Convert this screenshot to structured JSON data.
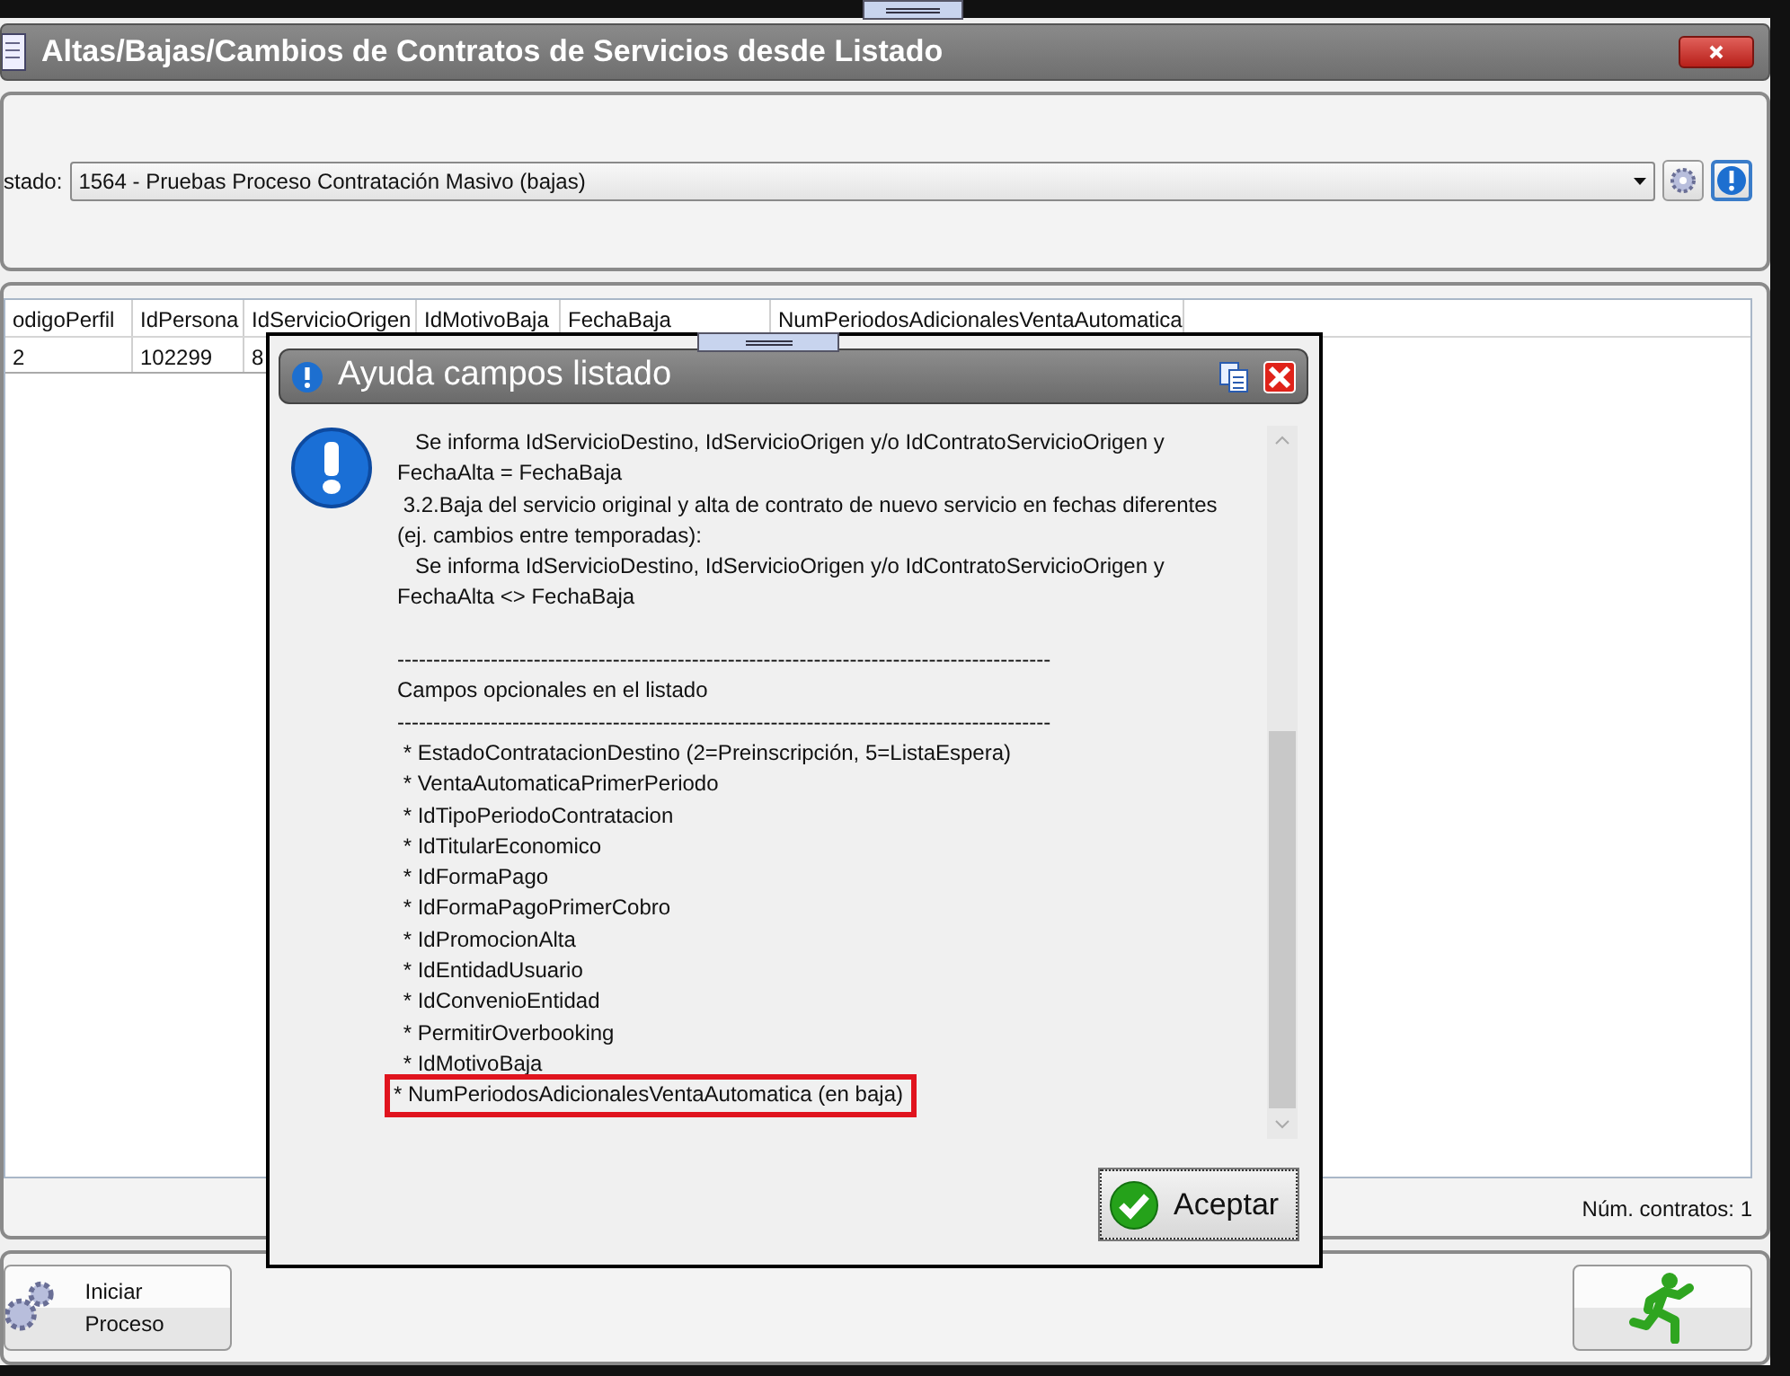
{
  "main_window": {
    "title": "Altas/Bajas/Cambios de Contratos de Servicios desde Listado"
  },
  "listado": {
    "label": "stado:",
    "value": "1564 - Pruebas Proceso Contratación Masivo (bajas)"
  },
  "table": {
    "columns": [
      "odigoPerfil",
      "IdPersona",
      "IdServicioOrigen",
      "IdMotivoBaja",
      "FechaBaja",
      "NumPeriodosAdicionalesVentaAutomatica"
    ],
    "rows": [
      [
        "2",
        "102299",
        "8"
      ]
    ]
  },
  "contract_count": "Núm. contratos: 1",
  "start_button": "Iniciar Proceso",
  "dialog": {
    "title": "Ayuda campos listado",
    "lines": [
      "   Se informa IdServicioDestino, IdServicioOrigen y/o IdContratoServicioOrigen y",
      "FechaAlta = FechaBaja",
      " 3.2.Baja del servicio original y alta de contrato de nuevo servicio en fechas diferentes",
      "(ej. cambios entre temporadas):",
      "   Se informa IdServicioDestino, IdServicioOrigen y/o IdContratoServicioOrigen y",
      "FechaAlta <> FechaBaja",
      "-------------------------------------------------------------------------------------------",
      "Campos opcionales en el listado",
      "-------------------------------------------------------------------------------------------"
    ],
    "optional_fields": [
      {
        "text": " * EstadoContratacionDestino (2=Preinscripción, 5=ListaEspera)",
        "highlighted": false
      },
      {
        "text": " * VentaAutomaticaPrimerPeriodo",
        "highlighted": false
      },
      {
        "text": " * IdTipoPeriodoContratacion",
        "highlighted": false
      },
      {
        "text": " * IdTitularEconomico",
        "highlighted": false
      },
      {
        "text": " * IdFormaPago",
        "highlighted": false
      },
      {
        "text": " * IdFormaPagoPrimerCobro",
        "highlighted": false
      },
      {
        "text": " * IdPromocionAlta",
        "highlighted": false
      },
      {
        "text": " * IdEntidadUsuario",
        "highlighted": false
      },
      {
        "text": " * IdConvenioEntidad",
        "highlighted": false
      },
      {
        "text": " * PermitirOverbooking",
        "highlighted": false
      },
      {
        "text": " * IdMotivoBaja",
        "highlighted": false
      },
      {
        "text": "* NumPeriodosAdicionalesVentaAutomatica (en baja)",
        "highlighted": true
      }
    ],
    "ok_button": "Aceptar"
  }
}
